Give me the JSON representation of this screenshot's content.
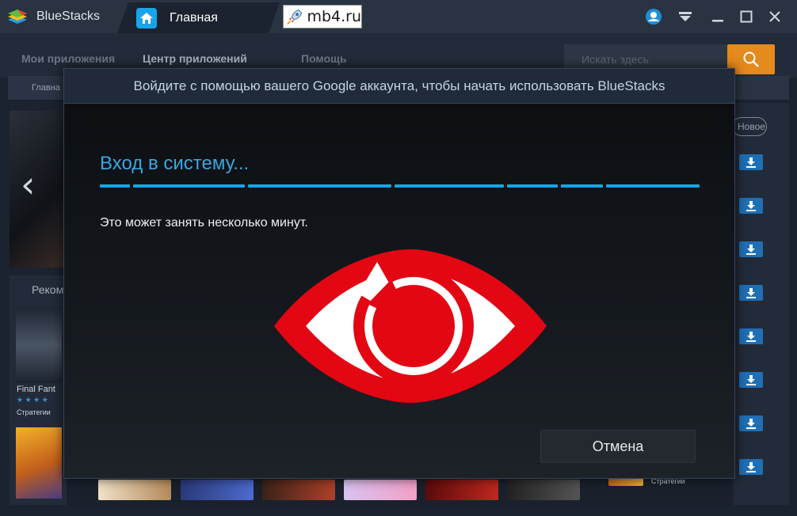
{
  "titlebar": {
    "app_name": "BlueStacks",
    "tab_home_label": "Главная",
    "watermark": "mb4.ru"
  },
  "app": {
    "nav": [
      "Мои приложения",
      "Центр приложений",
      "Помощь"
    ],
    "search_placeholder": "Искать здесь",
    "subnav_label": "Главна",
    "section_title": "Реком",
    "new_badge": "Новое",
    "game1": {
      "name": "Final Fant",
      "category": "Стратегии",
      "stars": "★ ★ ★ ★"
    },
    "bottom_category": "Стратегии"
  },
  "modal": {
    "header": "Войдите с помощью вашего Google аккаунта, чтобы начать использовать BlueStacks",
    "login_title": "Вход в систему...",
    "description": "Это может занять несколько минут.",
    "cancel_label": "Отмена"
  },
  "colors": {
    "accent_blue": "#16a6e6",
    "brand_orange": "#e58a1c",
    "eye_red": "#e30613",
    "titlebar": "#293342"
  },
  "icons": [
    "bluestacks-logo-icon",
    "home-icon",
    "rocket-icon",
    "account-icon",
    "chevron-down-icon",
    "minimize-icon",
    "maximize-icon",
    "close-icon",
    "search-icon",
    "chevron-left-icon",
    "download-icon",
    "eye-logo-icon"
  ]
}
